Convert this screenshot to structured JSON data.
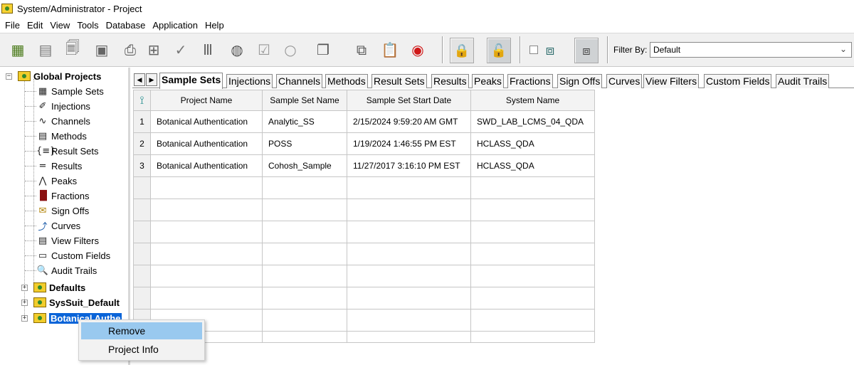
{
  "window": {
    "title": "System/Administrator - Project"
  },
  "menu": [
    "File",
    "Edit",
    "View",
    "Tools",
    "Database",
    "Application",
    "Help"
  ],
  "toolbar": {
    "icons": [
      "table-grid-icon",
      "table-list-icon",
      "report-preview-icon",
      "calculator-icon",
      "print-icon",
      "hierarchy-icon",
      "review-icon",
      "tubes-icon",
      "globe-icon",
      "check-circle-icon",
      "empty-circle-icon",
      "copy-window-icon",
      "copy-icon",
      "paste-icon",
      "stop-record-icon",
      "lock-icon",
      "unlock-icon",
      "save-view-icon",
      "save-view-as-icon"
    ],
    "filter_label": "Filter By:",
    "filter_value": "Default"
  },
  "tree": {
    "root": "Global Projects",
    "children": [
      "Sample Sets",
      "Injections",
      "Channels",
      "Methods",
      "Result Sets",
      "Results",
      "Peaks",
      "Fractions",
      "Sign Offs",
      "Curves",
      "View Filters",
      "Custom Fields",
      "Audit Trails"
    ],
    "projects": [
      "Defaults",
      "SysSuit_Default",
      "Botanical Authe"
    ]
  },
  "tabs": [
    "Sample Sets",
    "Injections",
    "Channels",
    "Methods",
    "Result Sets",
    "Results",
    "Peaks",
    "Fractions",
    "Sign Offs",
    "Curves",
    "View Filters",
    "Custom Fields",
    "Audit Trails"
  ],
  "grid": {
    "columns": [
      "Project Name",
      "Sample Set Name",
      "Sample Set Start Date",
      "System Name"
    ],
    "rows": [
      {
        "n": "1",
        "project": "Botanical Authentication",
        "name": "Analytic_SS",
        "date": "2/15/2024 9:59:20 AM GMT",
        "system": "SWD_LAB_LCMS_04_QDA"
      },
      {
        "n": "2",
        "project": "Botanical Authentication",
        "name": "POSS",
        "date": "1/19/2024 1:46:55 PM EST",
        "system": "HCLASS_QDA"
      },
      {
        "n": "3",
        "project": "Botanical Authentication",
        "name": "Cohosh_Sample",
        "date": "11/27/2017 3:16:10 PM EST",
        "system": "HCLASS_QDA"
      }
    ]
  },
  "context_menu": {
    "items": [
      "Remove",
      "Project Info"
    ]
  }
}
